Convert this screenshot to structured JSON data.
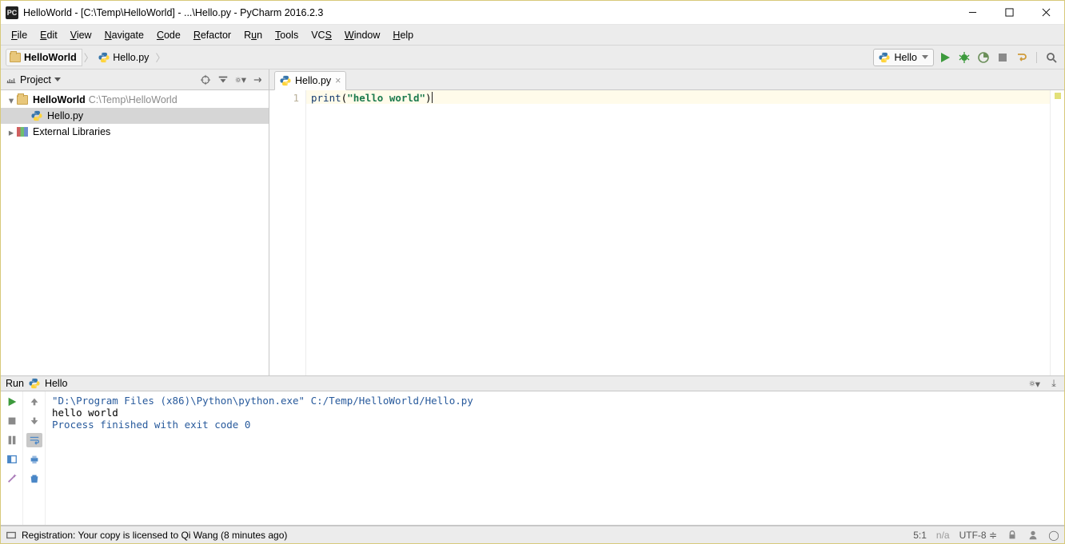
{
  "window": {
    "title": "HelloWorld - [C:\\Temp\\HelloWorld] - ...\\Hello.py - PyCharm 2016.2.3"
  },
  "menus": [
    "File",
    "Edit",
    "View",
    "Navigate",
    "Code",
    "Refactor",
    "Run",
    "Tools",
    "VCS",
    "Window",
    "Help"
  ],
  "breadcrumbs": {
    "project": "HelloWorld",
    "file": "Hello.py"
  },
  "run_config_selected": "Hello",
  "project_panel": {
    "title": "Project",
    "root": {
      "name": "HelloWorld",
      "path": "C:\\Temp\\HelloWorld"
    },
    "file": {
      "name": "Hello.py",
      "selected": true
    },
    "libs": {
      "name": "External Libraries"
    }
  },
  "editor": {
    "tab_file": "Hello.py",
    "line_no": "1",
    "code_tokens": {
      "fn": "print",
      "lp": "(",
      "str": "\"hello world\"",
      "rp": ")"
    }
  },
  "run_panel": {
    "header_label": "Run",
    "header_config": "Hello",
    "lines": {
      "cmd": "\"D:\\Program Files (x86)\\Python\\python.exe\" C:/Temp/HelloWorld/Hello.py",
      "out": "hello world",
      "blank": "",
      "exit": "Process finished with exit code 0"
    }
  },
  "status": {
    "left": "Registration: Your copy is licensed to Qi Wang (8 minutes ago)",
    "pos": "5:1",
    "na": "n/a",
    "enc": "UTF-8"
  }
}
